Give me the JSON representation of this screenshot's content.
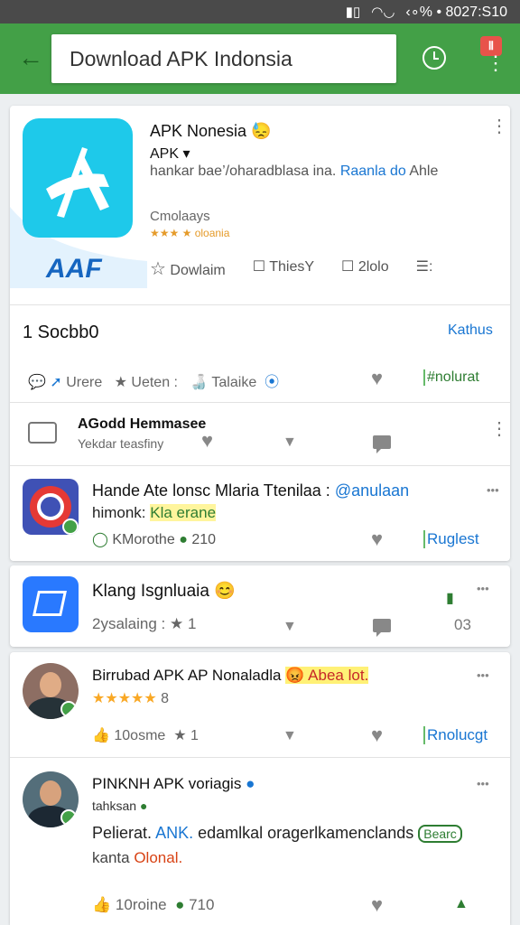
{
  "status": {
    "text": "‹∘% • 8027:S10",
    "icons": [
      "signal-icon",
      "wifi-icon",
      "battery-icon"
    ]
  },
  "appbar": {
    "back_icon": "←",
    "search_value": "Download APK Indonsia",
    "badge": "Ⅱ"
  },
  "hero": {
    "app_name": "APK Nonesia 😓",
    "sub": "APK ▾",
    "desc_a": "hankar bae’/oharadblasa ina.",
    "desc_b": "Raanla do",
    "desc_c": "Ahle",
    "category": "Cmolaays",
    "rating": "★★★ ★ oloania",
    "actions": [
      {
        "icon": "☆",
        "label": "Dowlaim"
      },
      {
        "icon": "☐",
        "label": "ThiesY"
      },
      {
        "icon": "☐",
        "label": "2lolo"
      },
      {
        "icon": "☰",
        "label": ":"
      }
    ]
  },
  "section": {
    "title": "1 Socbb0",
    "link": "Kathus"
  },
  "stats_row": {
    "a": "Urere",
    "b": "Ueten :",
    "c": "Talaike",
    "d": "#nolurat"
  },
  "sub_row": {
    "title": "AGodd Hemmasee",
    "sub": "Yekdar teasfiny"
  },
  "items": [
    {
      "title": "Hande Ate lonsc Mlaria Ttenilaa :",
      "handle": "@anulaan",
      "sub_a": "himonk:",
      "sub_b": "Kla erane",
      "stat_a": "KMorothe",
      "stat_b": "210",
      "tag": "Ruglest",
      "more": "•••"
    },
    {
      "title": "Klang Isgnluaia 😊",
      "stat_a": "2ysalaing :",
      "stat_b": "★ 1",
      "count": "03",
      "more": "•••"
    },
    {
      "title_a": "Birrubad APK AP Nonaladla",
      "title_b": "😡 Abea lot.",
      "stars": "★★★★★",
      "stars_b": "8",
      "stat_a": "10osme",
      "stat_b": "★ 1",
      "tag": "Rnolucgt",
      "more": "•••"
    },
    {
      "title_a": "PINKNH APK voriagis",
      "sub": "tahksan",
      "line2_a": "Pelierat.",
      "line2_b": "ANK.",
      "line2_c": "edamlkal oragerlkamenclands",
      "badge": "Bearc",
      "line3_a": "kanta",
      "line3_b": "Olonal.",
      "stat_a": "10roine",
      "stat_b": "710",
      "more": "•••"
    }
  ]
}
